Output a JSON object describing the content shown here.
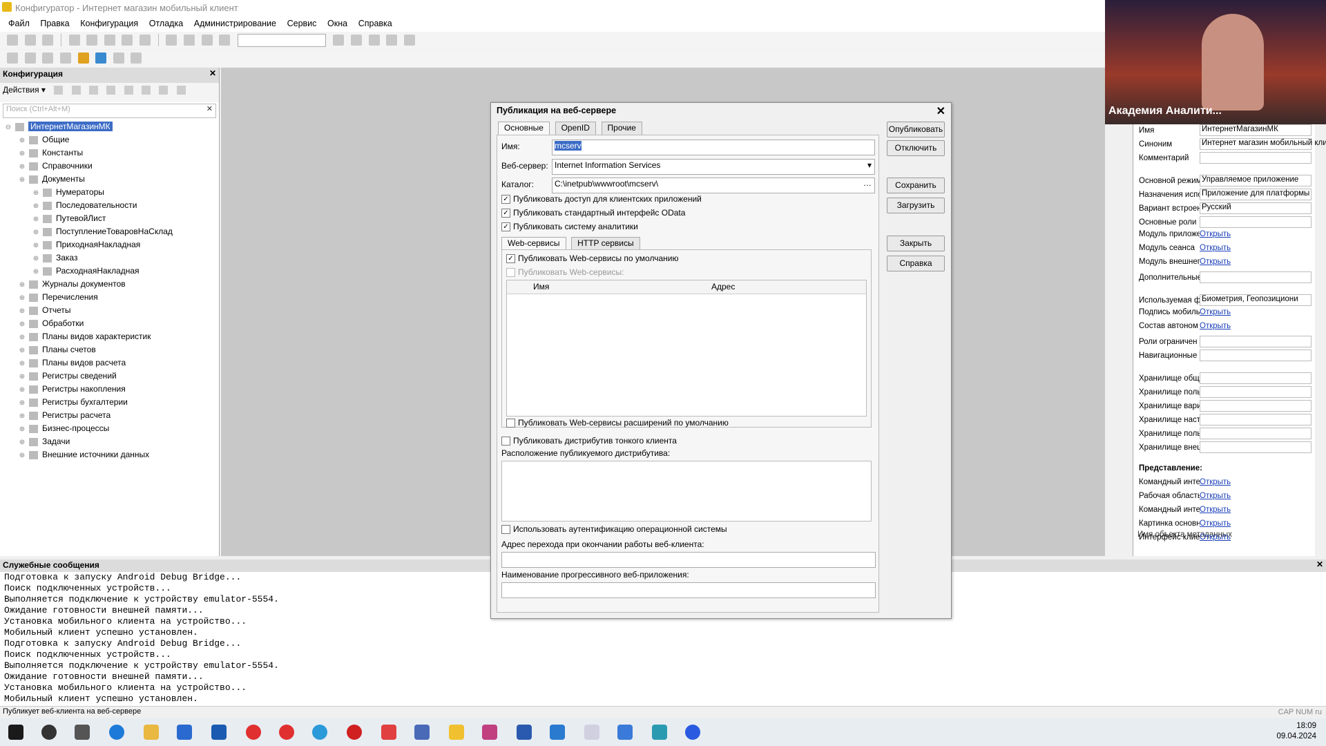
{
  "app": {
    "title": "Конфигуратор - Интернет магазин мобильный клиент"
  },
  "menu": [
    "Файл",
    "Правка",
    "Конфигурация",
    "Отладка",
    "Администрирование",
    "Сервис",
    "Окна",
    "Справка"
  ],
  "config_panel": {
    "title": "Конфигурация",
    "actions_label": "Действия",
    "search_placeholder": "Поиск (Ctrl+Alt+M)",
    "tree": [
      {
        "label": "ИнтернетМагазинМК",
        "level": 0,
        "selected": true
      },
      {
        "label": "Общие",
        "level": 1
      },
      {
        "label": "Константы",
        "level": 1
      },
      {
        "label": "Справочники",
        "level": 1
      },
      {
        "label": "Документы",
        "level": 1
      },
      {
        "label": "Нумераторы",
        "level": 2
      },
      {
        "label": "Последовательности",
        "level": 2
      },
      {
        "label": "ПутевойЛист",
        "level": 2
      },
      {
        "label": "ПоступлениеТоваровНаСклад",
        "level": 2
      },
      {
        "label": "ПриходнаяНакладная",
        "level": 2
      },
      {
        "label": "Заказ",
        "level": 2
      },
      {
        "label": "РасходнаяНакладная",
        "level": 2
      },
      {
        "label": "Журналы документов",
        "level": 1
      },
      {
        "label": "Перечисления",
        "level": 1
      },
      {
        "label": "Отчеты",
        "level": 1
      },
      {
        "label": "Обработки",
        "level": 1
      },
      {
        "label": "Планы видов характеристик",
        "level": 1
      },
      {
        "label": "Планы счетов",
        "level": 1
      },
      {
        "label": "Планы видов расчета",
        "level": 1
      },
      {
        "label": "Регистры сведений",
        "level": 1
      },
      {
        "label": "Регистры накопления",
        "level": 1
      },
      {
        "label": "Регистры бухгалтерии",
        "level": 1
      },
      {
        "label": "Регистры расчета",
        "level": 1
      },
      {
        "label": "Бизнес-процессы",
        "level": 1
      },
      {
        "label": "Задачи",
        "level": 1
      },
      {
        "label": "Внешние источники данных",
        "level": 1
      }
    ]
  },
  "dialog": {
    "title": "Публикация на веб-сервере",
    "tabs": [
      "Основные",
      "OpenID",
      "Прочие"
    ],
    "name_label": "Имя:",
    "name_value": "mcserv",
    "webserver_label": "Веб-сервер:",
    "webserver_value": "Internet Information Services",
    "catalog_label": "Каталог:",
    "catalog_value": "C:\\inetpub\\wwwroot\\mcserv\\",
    "chk_client_apps": "Публиковать доступ для клиентских приложений",
    "chk_odata": "Публиковать стандартный интерфейс OData",
    "chk_analytics": "Публиковать систему аналитики",
    "inner_tabs": [
      "Web-сервисы",
      "HTTP сервисы"
    ],
    "chk_ws_default": "Публиковать Web-сервисы по умолчанию",
    "chk_ws": "Публиковать Web-сервисы:",
    "grid_cols": [
      "Имя",
      "Адрес"
    ],
    "chk_ws_ext": "Публиковать Web-сервисы расширений по умолчанию",
    "chk_thin_dist": "Публиковать дистрибутив тонкого клиента",
    "dist_location_label": "Расположение публикуемого дистрибутива:",
    "chk_os_auth": "Использовать аутентификацию операционной системы",
    "exit_url_label": "Адрес перехода при окончании работы веб-клиента:",
    "pwa_label": "Наименование прогрессивного веб-приложения:",
    "buttons": [
      "Опубликовать",
      "Отключить",
      "Сохранить",
      "Загрузить",
      "Закрыть",
      "Справка"
    ]
  },
  "messages": {
    "title": "Служебные сообщения",
    "lines": [
      "Подготовка к запуску Android Debug Bridge...",
      "Поиск подключенных устройств...",
      "Выполняется подключение к устройству emulator-5554.",
      "Ожидание готовности внешней памяти...",
      "Установка мобильного клиента на устройство...",
      "Мобильный клиент успешно установлен.",
      "Подготовка к запуску Android Debug Bridge...",
      "Поиск подключенных устройств...",
      "Выполняется подключение к устройству emulator-5554.",
      "Ожидание готовности внешней памяти...",
      "Установка мобильного клиента на устройство...",
      "Мобильный клиент успешно установлен."
    ]
  },
  "status": {
    "text": "Публикует веб-клиента на веб-сервере",
    "indicators": "CAP  NUM  ru"
  },
  "properties": {
    "rows": [
      {
        "k": "Имя",
        "v": "ИнтернетМагазинМК",
        "box": true
      },
      {
        "k": "Синоним",
        "v": "Интернет магазин мобильный кли",
        "box": true
      },
      {
        "k": "Комментарий",
        "v": "",
        "box": true
      },
      {
        "k": "Основной режим",
        "v": "Управляемое приложение",
        "box": true
      },
      {
        "k": "Назначения испо",
        "v": "Приложение для платформы",
        "box": true
      },
      {
        "k": "Вариант встроен",
        "v": "Русский",
        "box": true
      },
      {
        "k": "Основные роли",
        "v": "",
        "box": true
      },
      {
        "k": "Модуль приложе",
        "v": "Открыть",
        "link": true
      },
      {
        "k": "Модуль сеанса",
        "v": "Открыть",
        "link": true
      },
      {
        "k": "Модуль внешнег",
        "v": "Открыть",
        "link": true
      },
      {
        "k": "Дополнительные",
        "v": "",
        "box": true
      },
      {
        "k": "Используемая ф",
        "v": "Биометрия, Геопозициони",
        "box": true
      },
      {
        "k": "Подпись мобилы",
        "v": "Открыть",
        "link": true
      },
      {
        "k": "Состав автоном",
        "v": "Открыть",
        "link": true
      },
      {
        "k": "Роли ограничен",
        "v": "",
        "box": true
      },
      {
        "k": "Навигационные с",
        "v": "",
        "box": true
      },
      {
        "k": "Хранилище общи",
        "v": "",
        "box": true
      },
      {
        "k": "Хранилище поль",
        "v": "",
        "box": true
      },
      {
        "k": "Хранилище вари",
        "v": "",
        "box": true
      },
      {
        "k": "Хранилище наст",
        "v": "",
        "box": true
      },
      {
        "k": "Хранилище поль",
        "v": "",
        "box": true
      },
      {
        "k": "Хранилище внеш",
        "v": "",
        "box": true
      },
      {
        "k": "Представление:",
        "v": "",
        "section": true
      },
      {
        "k": "Командный инте",
        "v": "Открыть",
        "link": true
      },
      {
        "k": "Рабочая область",
        "v": "Открыть",
        "link": true
      },
      {
        "k": "Командный инте",
        "v": "Открыть",
        "link": true
      },
      {
        "k": "Картинка основн",
        "v": "Открыть",
        "link": true
      },
      {
        "k": "Интерфейс клие",
        "v": "Открыть",
        "link": true
      }
    ],
    "footer": "Имя объекта метаданных"
  },
  "video": {
    "caption": "Академия Аналити..."
  },
  "clock": {
    "time": "18:09",
    "date": "09.04.2024"
  }
}
